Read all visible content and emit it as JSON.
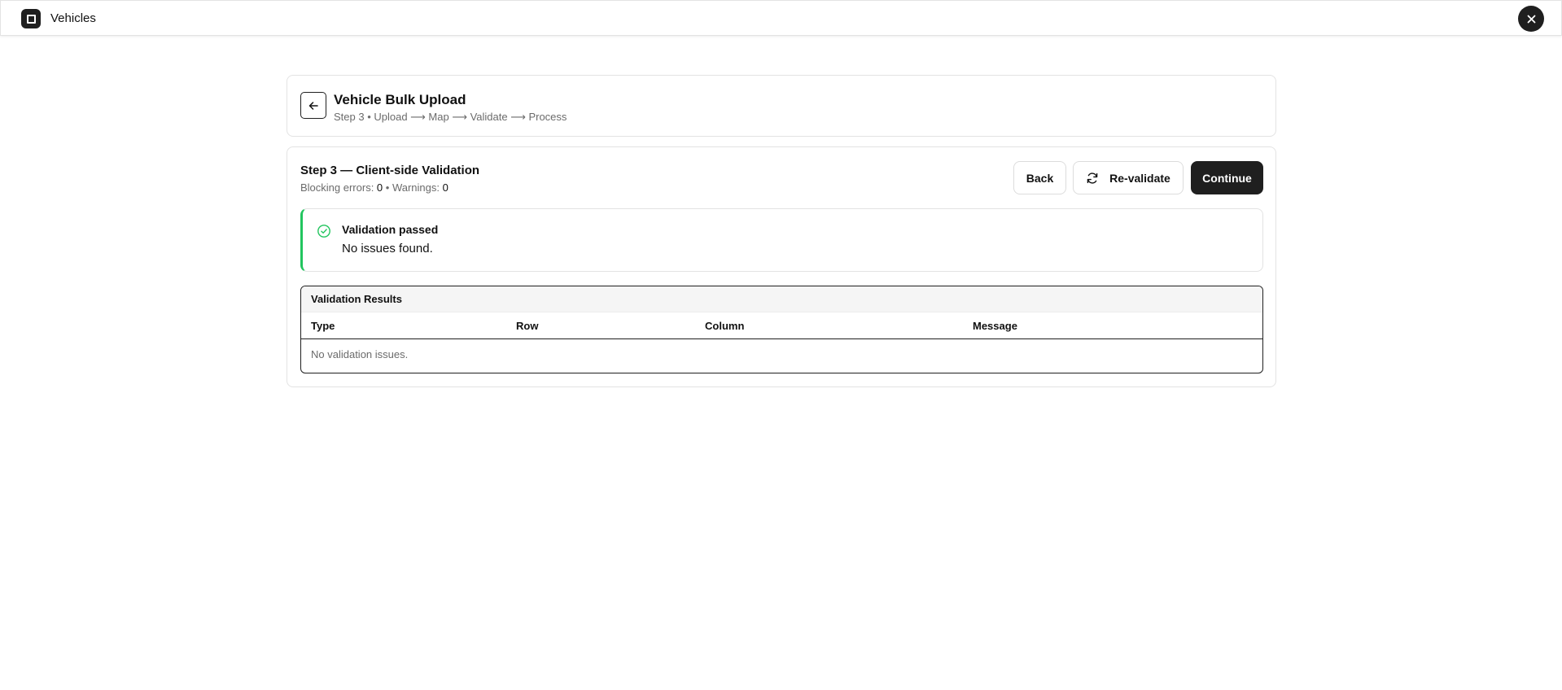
{
  "app": {
    "title": "Vehicles",
    "logo_icon": "square-logo-icon",
    "close_icon": "close-icon"
  },
  "header": {
    "title": "Vehicle Bulk Upload",
    "breadcrumb": "Step 3 • Upload ⟶ Map ⟶ Validate ⟶ Process",
    "back_icon": "arrow-left-icon"
  },
  "step": {
    "title": "Step 3 — Client-side Validation",
    "blocking_label": "Blocking errors: ",
    "blocking_count": "0",
    "separator": " • ",
    "warnings_label": "Warnings: ",
    "warnings_count": "0"
  },
  "actions": {
    "back_label": "Back",
    "revalidate_label": "Re-validate",
    "revalidate_icon": "refresh-icon",
    "continue_label": "Continue"
  },
  "alert": {
    "title": "Validation passed",
    "message": "No issues found.",
    "icon": "check-circle-icon",
    "accent_color": "#22c55e"
  },
  "results": {
    "title": "Validation Results",
    "columns": [
      "Type",
      "Row",
      "Column",
      "Message"
    ],
    "empty_text": "No validation issues."
  },
  "colors": {
    "primary": "#1f1f1f",
    "success": "#22c55e",
    "muted_text": "#6b6b6b",
    "border": "#e3e3e3"
  }
}
